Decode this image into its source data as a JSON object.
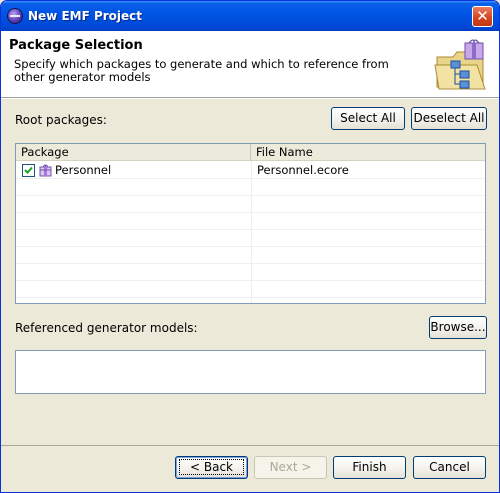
{
  "window": {
    "title": "New EMF Project"
  },
  "header": {
    "title": "Package Selection",
    "description": "Specify which packages to generate and which to reference from other generator models"
  },
  "root_packages": {
    "label": "Root packages:",
    "select_all": "Select All",
    "deselect_all": "Deselect All",
    "columns": [
      "Package",
      "File Name"
    ],
    "rows": [
      {
        "package": "Personnel",
        "file_name": "Personnel.ecore",
        "checked": true
      }
    ]
  },
  "referenced": {
    "label": "Referenced generator models:",
    "browse": "Browse..."
  },
  "footer": {
    "back": "< Back",
    "next": "Next >",
    "finish": "Finish",
    "cancel": "Cancel"
  },
  "colors": {
    "titlebar": "#0055E5",
    "dialog_bg": "#ECE9D8",
    "button_border": "#003C74"
  }
}
